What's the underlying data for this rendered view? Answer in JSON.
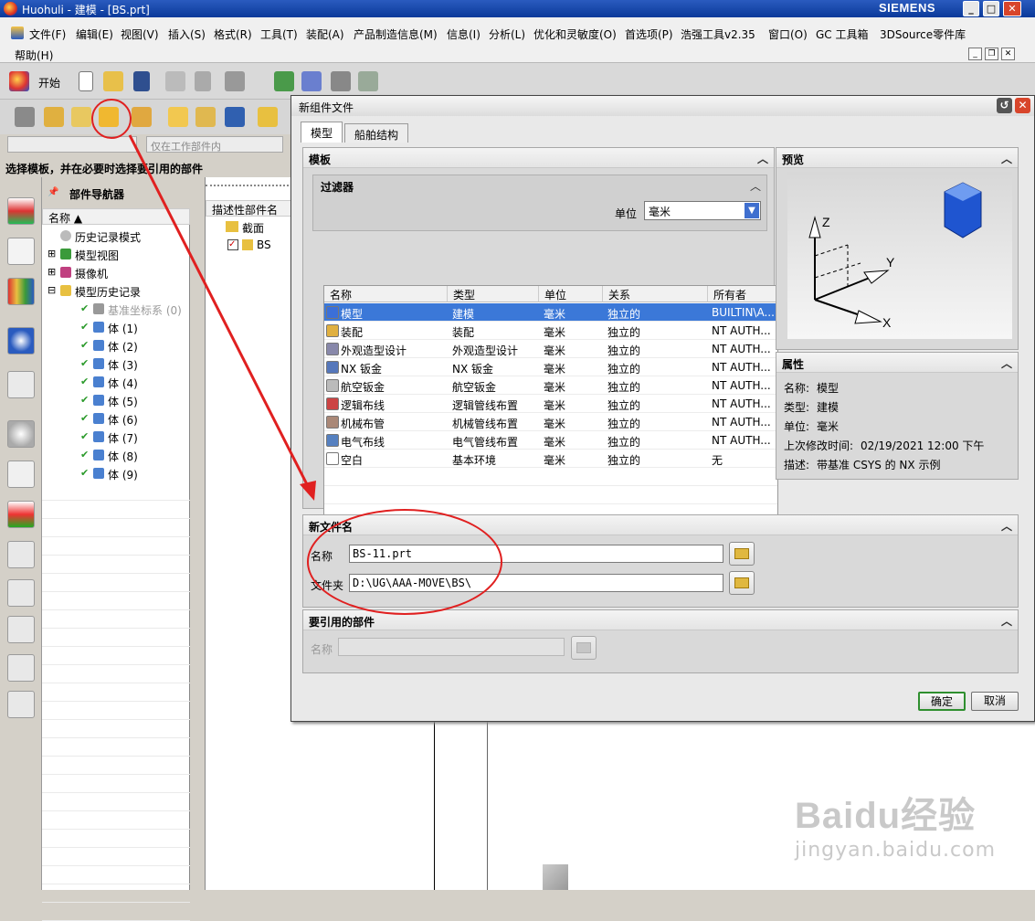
{
  "window": {
    "title": "Huohuli - 建模 - [BS.prt]",
    "brand": "SIEMENS"
  },
  "menu": {
    "items": [
      "文件(F)",
      "编辑(E)",
      "视图(V)",
      "插入(S)",
      "格式(R)",
      "工具(T)",
      "装配(A)",
      "产品制造信息(M)",
      "信息(I)",
      "分析(L)",
      "优化和灵敏度(O)",
      "首选项(P)",
      "浩强工具v2.35",
      "窗口(O)",
      "GC 工具箱",
      "3DSource零件库"
    ],
    "help": "帮助(H)"
  },
  "toolbar": {
    "start_label": "开始"
  },
  "filter": {
    "scope_value": "仅在工作部件内"
  },
  "status": {
    "text": "选择模板，并在必要时选择要引用的部件"
  },
  "navigator": {
    "title": "部件导航器",
    "column": "名称",
    "items": [
      {
        "label": "历史记录模式",
        "icon": "clock-icon"
      },
      {
        "label": "模型视图",
        "icon": "views-icon"
      },
      {
        "label": "摄像机",
        "icon": "camera-icon"
      },
      {
        "label": "模型历史记录",
        "icon": "folder-icon"
      },
      {
        "label": "基准坐标系 (0)",
        "icon": "csys-icon"
      },
      {
        "label": "体 (1)",
        "icon": "body-icon"
      },
      {
        "label": "体 (2)",
        "icon": "body-icon"
      },
      {
        "label": "体 (3)",
        "icon": "body-icon"
      },
      {
        "label": "体 (4)",
        "icon": "body-icon"
      },
      {
        "label": "体 (5)",
        "icon": "body-icon"
      },
      {
        "label": "体 (6)",
        "icon": "body-icon"
      },
      {
        "label": "体 (7)",
        "icon": "body-icon"
      },
      {
        "label": "体 (8)",
        "icon": "body-icon"
      },
      {
        "label": "体 (9)",
        "icon": "body-icon"
      }
    ]
  },
  "assembly_nav": {
    "column": "描述性部件名",
    "items": [
      {
        "label": "截面"
      },
      {
        "label": "BS"
      }
    ]
  },
  "dialog": {
    "title": "新组件文件",
    "tabs": [
      "模型",
      "船舶结构"
    ],
    "template_section": "模板",
    "filter_section": "过滤器",
    "unit_label": "单位",
    "unit_value": "毫米",
    "columns": [
      "名称",
      "类型",
      "单位",
      "关系",
      "所有者"
    ],
    "rows": [
      {
        "name": "模型",
        "type": "建模",
        "unit": "毫米",
        "relation": "独立的",
        "owner": "BUILTIN\\A...",
        "icon": "model-icon"
      },
      {
        "name": "装配",
        "type": "装配",
        "unit": "毫米",
        "relation": "独立的",
        "owner": "NT AUTH...",
        "icon": "assembly-icon"
      },
      {
        "name": "外观造型设计",
        "type": "外观造型设计",
        "unit": "毫米",
        "relation": "独立的",
        "owner": "NT AUTH...",
        "icon": "shape-icon"
      },
      {
        "name": "NX 钣金",
        "type": "NX 钣金",
        "unit": "毫米",
        "relation": "独立的",
        "owner": "NT AUTH...",
        "icon": "sheetmetal-icon"
      },
      {
        "name": "航空钣金",
        "type": "航空钣金",
        "unit": "毫米",
        "relation": "独立的",
        "owner": "NT AUTH...",
        "icon": "aero-sheetmetal-icon"
      },
      {
        "name": "逻辑布线",
        "type": "逻辑管线布置",
        "unit": "毫米",
        "relation": "独立的",
        "owner": "NT AUTH...",
        "icon": "logic-routing-icon"
      },
      {
        "name": "机械布管",
        "type": "机械管线布置",
        "unit": "毫米",
        "relation": "独立的",
        "owner": "NT AUTH...",
        "icon": "mech-routing-icon"
      },
      {
        "name": "电气布线",
        "type": "电气管线布置",
        "unit": "毫米",
        "relation": "独立的",
        "owner": "NT AUTH...",
        "icon": "elec-routing-icon"
      },
      {
        "name": "空白",
        "type": "基本环境",
        "unit": "毫米",
        "relation": "独立的",
        "owner": "无",
        "icon": "blank-icon"
      }
    ],
    "preview_section": "预览",
    "preview_axes": {
      "z": "Z",
      "y": "Y",
      "x": "X"
    },
    "props_section": "属性",
    "props": [
      {
        "label": "名称:",
        "value": "模型"
      },
      {
        "label": "类型:",
        "value": "建模"
      },
      {
        "label": "单位:",
        "value": "毫米"
      },
      {
        "label": "上次修改时间:",
        "value": "02/19/2021 12:00 下午"
      },
      {
        "label": "描述:",
        "value": "带基准 CSYS 的 NX 示例"
      }
    ],
    "newfile_section": "新文件名",
    "name_label": "名称",
    "name_value": "BS-11.prt",
    "folder_label": "文件夹",
    "folder_value": "D:\\UG\\AAA-MOVE\\BS\\",
    "ref_section": "要引用的部件",
    "ref_name_label": "名称",
    "ok": "确定",
    "cancel": "取消"
  },
  "watermark": {
    "brand": "Baidu经验",
    "url": "jingyan.baidu.com"
  },
  "colors": {
    "selection": "#3b78d8",
    "annotation": "#e02020",
    "titlebar": "#0b3a9a",
    "ok_border": "#2f8f2f"
  }
}
